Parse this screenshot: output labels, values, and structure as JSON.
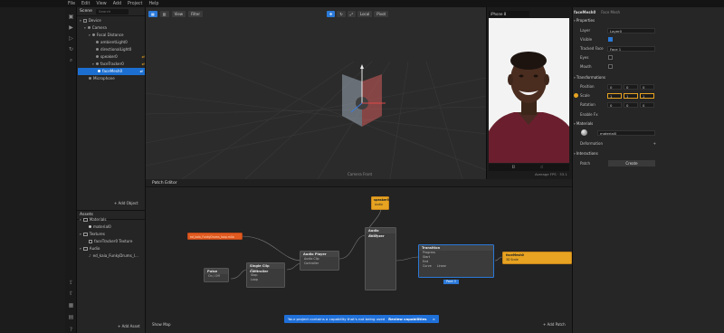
{
  "menubar": {
    "items": [
      "File",
      "Edit",
      "View",
      "Add",
      "Project",
      "Help"
    ]
  },
  "scene": {
    "tab": "Scene",
    "search_placeholder": "Search",
    "tree": [
      {
        "label": "Device",
        "depth": 0
      },
      {
        "label": "Camera",
        "depth": 1
      },
      {
        "label": "Focal Distance",
        "depth": 2
      },
      {
        "label": "ambientLight0",
        "depth": 3
      },
      {
        "label": "directionalLight0",
        "depth": 3
      },
      {
        "label": "speaker0",
        "depth": 3
      },
      {
        "label": "faceTracker0",
        "depth": 2
      },
      {
        "label": "faceMesh0",
        "depth": 3,
        "selected": true
      },
      {
        "label": "Microphone",
        "depth": 1
      }
    ],
    "add_object": "+ Add Object"
  },
  "assets": {
    "tab": "Assets",
    "tree": [
      {
        "label": "Materials",
        "depth": 0
      },
      {
        "label": "material0",
        "depth": 1
      },
      {
        "label": "Textures",
        "depth": 0
      },
      {
        "label": "faceTracker0 Texture",
        "depth": 1
      },
      {
        "label": "Audio",
        "depth": 0
      },
      {
        "label": "ed_kaia_FunkyDrums_l...",
        "depth": 1
      }
    ],
    "add_asset": "+ Add Asset"
  },
  "viewport": {
    "view_label": "View",
    "filter_label": "Filter",
    "local_label": "Local",
    "pivot_label": "Pivot",
    "camera_label": "Camera Front"
  },
  "preview": {
    "device": "iPhone 8",
    "fps_text": "Average FPS · 33.1"
  },
  "patch_editor": {
    "title": "Patch Editor",
    "show_map": "Show Map",
    "add_patch": "+ Add Patch",
    "banner_text": "Your project contains a capability that's not being used",
    "banner_action": "Review capabilities",
    "nodes": {
      "speaker": {
        "title": "speaker0",
        "rows": [
          "Audio"
        ]
      },
      "audio_asset": {
        "title": "ed_kaia_FunkyDrums_loop.m4a"
      },
      "pulse": {
        "title": "Pulse",
        "rows": [
          "On / Off"
        ]
      },
      "single_clip": {
        "title": "Single Clip Controller",
        "rows": [
          "Play",
          "Stop",
          "Loop"
        ]
      },
      "audio_player": {
        "title": "Audio Player",
        "rows": [
          "Audio Clip",
          "Controller"
        ]
      },
      "audio_analyzer": {
        "title": "Audio Analyzer",
        "rows": [
          "Audio"
        ]
      },
      "transition": {
        "title": "Transition",
        "rows": [
          "Progress",
          "Start",
          "End",
          "Curve"
        ],
        "curve_value": "Linear",
        "row_values": [
          "1",
          "1",
          "1",
          "1",
          "1",
          "1"
        ]
      },
      "facemesh": {
        "title": "faceMesh0",
        "rows": [
          "3D Scale"
        ],
        "values": [
          "1",
          "1",
          "1"
        ]
      },
      "pack_label": "Pack 3"
    }
  },
  "inspector": {
    "title": "faceMesh0",
    "subtitle": "Face Mesh",
    "properties_header": "Properties",
    "layer_label": "Layer",
    "layer_value": "Layer0",
    "visible_label": "Visible",
    "tracked_face_label": "Tracked Face",
    "tracked_face_value": "Face 1",
    "eyes_label": "Eyes",
    "mouth_label": "Mouth",
    "transformations_header": "Transformations",
    "position_label": "Position",
    "position_values": [
      "0",
      "0",
      "0"
    ],
    "scale_label": "Scale",
    "scale_values": [
      "1",
      "1",
      "1"
    ],
    "rotation_label": "Rotation",
    "rotation_values": [
      "0",
      "0",
      "0"
    ],
    "enable_fx_label": "Enable Fx",
    "materials_header": "Materials",
    "material_value": "material0",
    "deformation_label": "Deformation",
    "interactions_header": "Interactions",
    "patch_label": "Patch",
    "create_label": "Create"
  },
  "colors": {
    "accent": "#2b79d8",
    "selection": "#1c6fd1",
    "patch_orange": "#e7a321",
    "asset_node": "#e05a1f",
    "banner": "#1f6fd8"
  }
}
